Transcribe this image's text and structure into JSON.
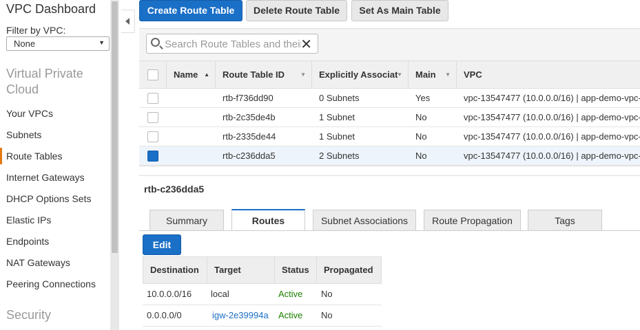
{
  "sidebar": {
    "title": "VPC Dashboard",
    "filter_label": "Filter by VPC:",
    "filter_value": "None",
    "section_vpc": "Virtual Private Cloud",
    "items": [
      {
        "label": "Your VPCs"
      },
      {
        "label": "Subnets"
      },
      {
        "label": "Route Tables"
      },
      {
        "label": "Internet Gateways"
      },
      {
        "label": "DHCP Options Sets"
      },
      {
        "label": "Elastic IPs"
      },
      {
        "label": "Endpoints"
      },
      {
        "label": "NAT Gateways"
      },
      {
        "label": "Peering Connections"
      }
    ],
    "section_security": "Security"
  },
  "toolbar": {
    "create_label": "Create Route Table",
    "delete_label": "Delete Route Table",
    "set_main_label": "Set As Main Table"
  },
  "search": {
    "placeholder": "Search Route Tables and their"
  },
  "table": {
    "columns": {
      "name": "Name",
      "route_table_id": "Route Table ID",
      "explicitly_associated": "Explicitly Associat",
      "main": "Main",
      "vpc": "VPC"
    },
    "rows": [
      {
        "name": "",
        "id": "rtb-f736dd90",
        "assoc": "0 Subnets",
        "main": "Yes",
        "vpc": "vpc-13547477 (10.0.0.0/16) | app-demo-vpc-",
        "selected": false
      },
      {
        "name": "",
        "id": "rtb-2c35de4b",
        "assoc": "1 Subnet",
        "main": "No",
        "vpc": "vpc-13547477 (10.0.0.0/16) | app-demo-vpc-",
        "selected": false
      },
      {
        "name": "",
        "id": "rtb-2335de44",
        "assoc": "1 Subnet",
        "main": "No",
        "vpc": "vpc-13547477 (10.0.0.0/16) | app-demo-vpc-",
        "selected": false
      },
      {
        "name": "",
        "id": "rtb-c236dda5",
        "assoc": "2 Subnets",
        "main": "No",
        "vpc": "vpc-13547477 (10.0.0.0/16) | app-demo-vpc-",
        "selected": true
      }
    ]
  },
  "detail": {
    "title": "rtb-c236dda5",
    "tabs": [
      {
        "label": "Summary"
      },
      {
        "label": "Routes"
      },
      {
        "label": "Subnet Associations"
      },
      {
        "label": "Route Propagation"
      },
      {
        "label": "Tags"
      }
    ],
    "active_tab": "Routes",
    "edit_label": "Edit",
    "routes": {
      "headers": {
        "destination": "Destination",
        "target": "Target",
        "status": "Status",
        "propagated": "Propagated"
      },
      "rows": [
        {
          "destination": "10.0.0.0/16",
          "target": "local",
          "status": "Active",
          "propagated": "No"
        },
        {
          "destination": "0.0.0.0/0",
          "target": "igw-2e39994a",
          "status": "Active",
          "propagated": "No"
        }
      ]
    }
  },
  "colors": {
    "primary": "#1a6fc6",
    "active_status": "#1d8102",
    "active_nav": "#e47911"
  }
}
